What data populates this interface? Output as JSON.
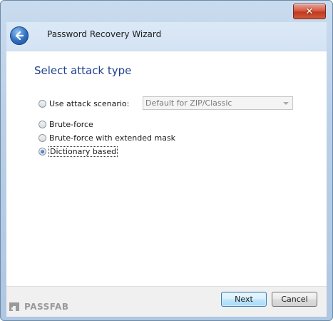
{
  "window": {
    "title": "Password Recovery Wizard",
    "close_glyph": "✕"
  },
  "page": {
    "heading": "Select attack type"
  },
  "options": {
    "use_scenario": {
      "label": "Use attack scenario:",
      "checked": false
    },
    "brute_force": {
      "label": "Brute-force",
      "checked": false
    },
    "brute_force_mask": {
      "label": "Brute-force with extended mask",
      "checked": false
    },
    "dictionary": {
      "label": "Dictionary based",
      "checked": true
    }
  },
  "scenario_select": {
    "value": "Default for ZIP/Classic",
    "disabled": true
  },
  "buttons": {
    "next": "Next",
    "cancel": "Cancel"
  },
  "watermark": {
    "text": "PASSFAB"
  },
  "icons": {
    "back": "back-arrow-icon",
    "close": "close-icon",
    "chevron": "chevron-down-icon",
    "logo": "passfab-logo-icon"
  },
  "colors": {
    "heading": "#1f3f8e",
    "title_bar": "#b9cfe7",
    "close_button": "#c0391f",
    "back_button": "#2d6fc0"
  }
}
